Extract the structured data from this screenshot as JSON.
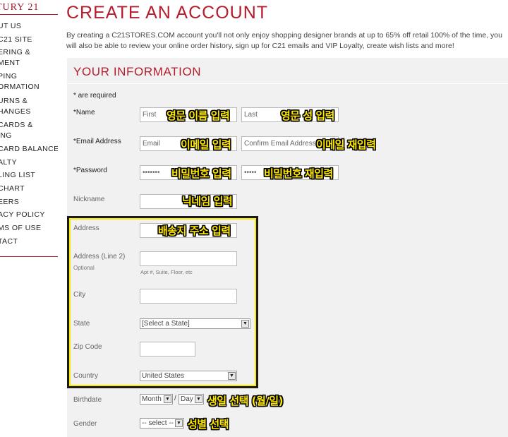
{
  "sidebar": {
    "brand": "TURY 21",
    "items": [
      "UT US",
      "C21 SITE",
      "ERING &",
      "MENT",
      "PING",
      "ORMATION",
      "URNS &",
      "HANGES",
      "CARDS &",
      "ING",
      "CARD BALANCE",
      "ALTY",
      "LING LIST",
      "CHART",
      "EERS",
      "ACY POLICY",
      "MS OF USE",
      "TACT"
    ]
  },
  "page": {
    "title": "CREATE AN ACCOUNT",
    "intro": "By creating a C21STORES.COM account you'll not only enjoy shopping designer brands at up to 65% off retail 100% of the time, you will also be able to review your online order history, sign up for C21 emails and VIP Loyalty, create wish lists and more!"
  },
  "form": {
    "section_title": "YOUR INFORMATION",
    "required_note": "* are required",
    "name_label": "*Name",
    "first_placeholder": "First",
    "last_placeholder": "Last",
    "email_label": "*Email Address",
    "email_placeholder": "Email",
    "confirm_email_placeholder": "Confirm Email Address",
    "password_label": "*Password",
    "password_mask": "•••••••",
    "confirm_password_mask": "•••••",
    "nickname_label": "Nickname",
    "address_label": "Address",
    "address2_label": "Address (Line 2)",
    "address2_optional": "Optional",
    "address2_hint": "Apt #, Suite, Floor, etc",
    "city_label": "City",
    "state_label": "State",
    "state_value": "[Select a State]",
    "zip_label": "Zip Code",
    "country_label": "Country",
    "country_value": "United States",
    "birthdate_label": "Birthdate",
    "month_value": "Month",
    "day_value": "Day",
    "date_separator": "/",
    "gender_label": "Gender",
    "gender_value": "-- select --"
  },
  "annotations": {
    "first_name": "영문 이름 입력",
    "last_name": "영문 성 입력",
    "email": "이메일 입력",
    "email_confirm": "이메일 재입력",
    "password": "비밀번호 입력",
    "password_confirm": "비밀번호 재입력",
    "nickname": "닉네임 입력",
    "address": "배송지 주소 입력",
    "birthdate": "생일 선택 (월/일)",
    "gender": "성별 선택"
  },
  "colors": {
    "accent": "#b51d2e",
    "panel_bg": "#f1f1f1",
    "annotation_text": "#ffe800"
  }
}
